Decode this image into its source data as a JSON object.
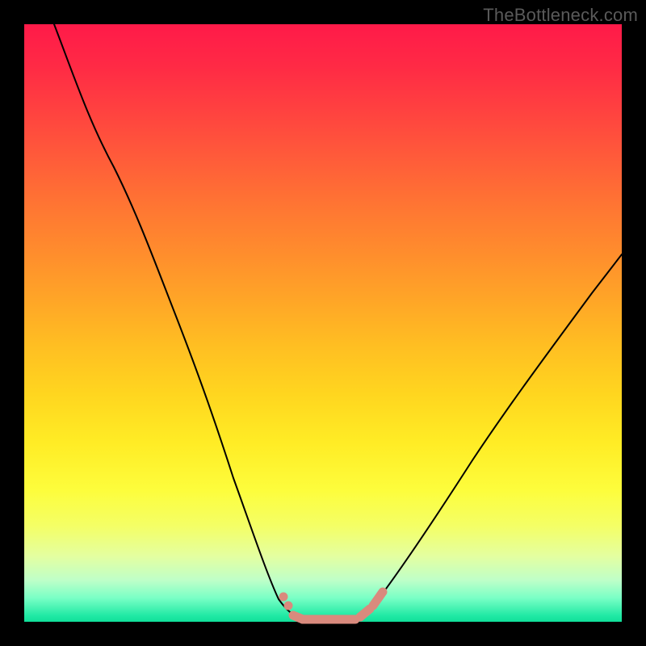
{
  "watermark": "TheBottleneck.com",
  "chart_data": {
    "type": "line",
    "title": "",
    "xlabel": "",
    "ylabel": "",
    "xlim": [
      0,
      100
    ],
    "ylim": [
      0,
      100
    ],
    "grid": false,
    "legend": false,
    "series": [
      {
        "name": "bottleneck-curve",
        "x": [
          5,
          10,
          15,
          20,
          25,
          30,
          35,
          40,
          42,
          45,
          47,
          50,
          52,
          55,
          57,
          60,
          65,
          70,
          75,
          80,
          85,
          90,
          95,
          100
        ],
        "y": [
          100,
          88,
          76,
          64,
          52,
          40,
          28,
          16,
          9,
          3,
          1,
          0,
          0,
          0,
          1,
          3,
          8,
          14,
          21,
          28,
          35,
          42,
          49,
          55
        ]
      }
    ],
    "highlight": {
      "name": "optimal-range",
      "x_range": [
        45,
        58
      ],
      "y": 0
    },
    "background_gradient_stops": [
      {
        "pct": 0,
        "color": "#ff1a49"
      },
      {
        "pct": 50,
        "color": "#ffbf22"
      },
      {
        "pct": 80,
        "color": "#fdfd3c"
      },
      {
        "pct": 100,
        "color": "#10df9a"
      }
    ]
  }
}
